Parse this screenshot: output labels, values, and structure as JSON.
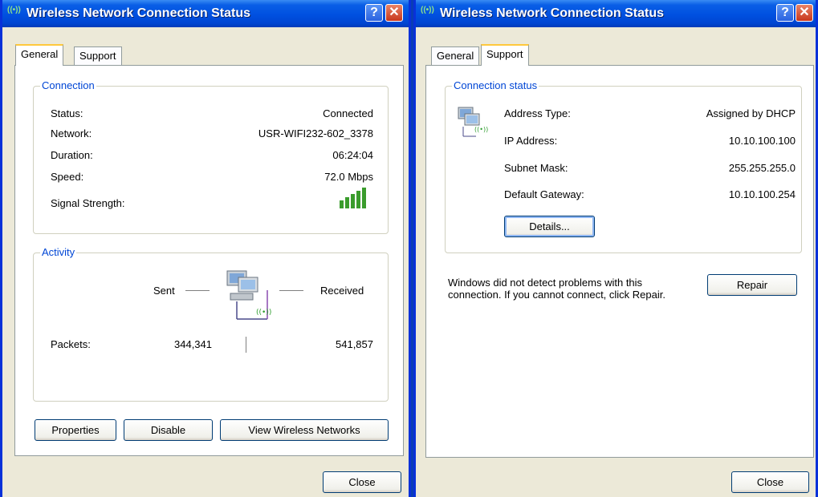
{
  "colors": {
    "titlebar": "#0054e3",
    "group_title": "#0046d5",
    "signal_bars": "#3a9c2c",
    "window_bg": "#ece9d8"
  },
  "left": {
    "title": "Wireless Network Connection Status",
    "tabs": [
      "General",
      "Support"
    ],
    "connection": {
      "title": "Connection",
      "rows": [
        {
          "label": "Status:",
          "value": "Connected"
        },
        {
          "label": "Network:",
          "value": "USR-WIFI232-602_3378"
        },
        {
          "label": "Duration:",
          "value": "06:24:04"
        },
        {
          "label": "Speed:",
          "value": "72.0 Mbps"
        }
      ],
      "signal_label": "Signal Strength:",
      "signal_bars_lit": 5
    },
    "activity": {
      "title": "Activity",
      "sent_label": "Sent",
      "received_label": "Received",
      "packets_label": "Packets:",
      "packets_sent": "344,341",
      "packets_received": "541,857"
    },
    "buttons": {
      "properties": "Properties",
      "disable": "Disable",
      "view_wireless": "View Wireless Networks",
      "close": "Close"
    }
  },
  "right": {
    "title": "Wireless Network Connection Status",
    "tabs": [
      "General",
      "Support"
    ],
    "connection_status": {
      "title": "Connection status",
      "rows": [
        {
          "label": "Address Type:",
          "value": "Assigned by DHCP"
        },
        {
          "label": "IP Address:",
          "value": "10.10.100.100"
        },
        {
          "label": "Subnet Mask:",
          "value": "255.255.255.0"
        },
        {
          "label": "Default Gateway:",
          "value": "10.10.100.254"
        }
      ],
      "details_label": "Details..."
    },
    "message": "Windows did not detect problems with this connection. If you cannot connect, click Repair.",
    "buttons": {
      "repair": "Repair",
      "close": "Close"
    }
  },
  "icons": {
    "title_icon": "wireless-antenna-icon",
    "network_icon": "network-computers-icon",
    "help_icon": "help-icon",
    "close_icon": "close-icon",
    "signal_icon": "signal-strength-icon"
  }
}
